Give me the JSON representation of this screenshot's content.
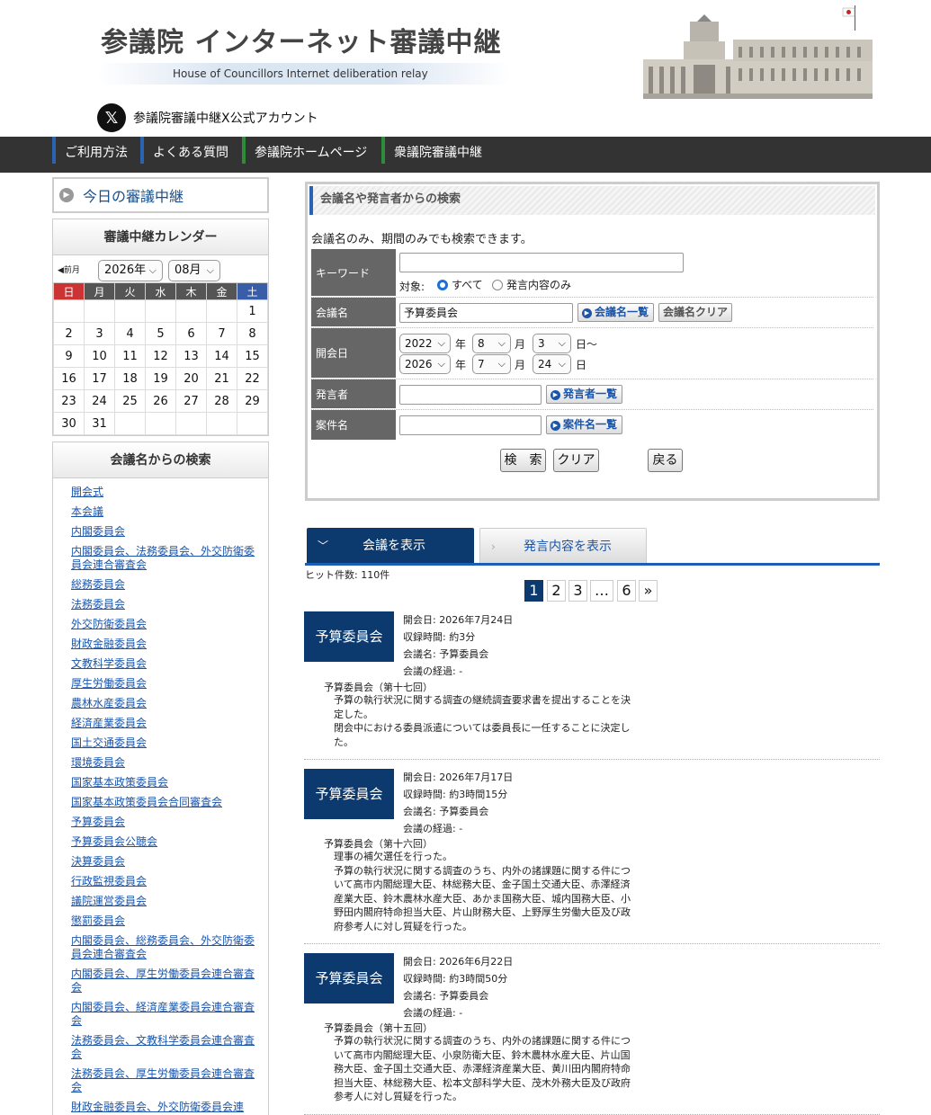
{
  "header": {
    "title": "参議院 インターネット審議中継",
    "subtitle": "House of Councillors Internet deliberation relay",
    "x_account": "参議院審議中継X公式アカウント"
  },
  "nav": {
    "items": [
      {
        "label": "ご利用方法",
        "color": "#2a63b0"
      },
      {
        "label": "よくある質問",
        "color": "#2a63b0"
      },
      {
        "label": "参議院ホームページ",
        "color": "#2e8b3a"
      },
      {
        "label": "衆議院審議中継",
        "color": "#2e8b3a"
      }
    ]
  },
  "sidebar": {
    "today": "今日の審議中継",
    "calendar": {
      "title": "審議中継カレンダー",
      "prev": "◀前月",
      "year": "2026年",
      "month": "08月",
      "weekdays": [
        "日",
        "月",
        "火",
        "水",
        "木",
        "金",
        "土"
      ],
      "weeks": [
        [
          "",
          "",
          "",
          "",
          "",
          "",
          "1"
        ],
        [
          "2",
          "3",
          "4",
          "5",
          "6",
          "7",
          "8"
        ],
        [
          "9",
          "10",
          "11",
          "12",
          "13",
          "14",
          "15"
        ],
        [
          "16",
          "17",
          "18",
          "19",
          "20",
          "21",
          "22"
        ],
        [
          "23",
          "24",
          "25",
          "26",
          "27",
          "28",
          "29"
        ],
        [
          "30",
          "31",
          "",
          "",
          "",
          "",
          ""
        ]
      ]
    },
    "committee_search": {
      "title": "会議名からの検索",
      "links": [
        "開会式",
        "本会議",
        "内閣委員会",
        "内閣委員会、法務委員会、外交防衛委員会連合審査会",
        "総務委員会",
        "法務委員会",
        "外交防衛委員会",
        "財政金融委員会",
        "文教科学委員会",
        "厚生労働委員会",
        "農林水産委員会",
        "経済産業委員会",
        "国土交通委員会",
        "環境委員会",
        "国家基本政策委員会",
        "国家基本政策委員会合同審査会",
        "予算委員会",
        "予算委員会公聴会",
        "決算委員会",
        "行政監視委員会",
        "議院運営委員会",
        "懲罰委員会",
        "内閣委員会、総務委員会、外交防衛委員会連合審査会",
        "内閣委員会、厚生労働委員会連合審査会",
        "内閣委員会、経済産業委員会連合審査会",
        "法務委員会、文教科学委員会連合審査会",
        "法務委員会、厚生労働委員会連合審査会",
        "財政金融委員会、外交防衛委員会連"
      ]
    }
  },
  "search": {
    "title": "会議名や発言者からの検索",
    "note": "会議名のみ、期間のみでも検索できます。",
    "keyword_label": "キーワード",
    "keyword_value": "",
    "target_label": "対象:",
    "target_all": "すべて",
    "target_speech": "発言内容のみ",
    "meeting_label": "会議名",
    "meeting_value": "予算委員会",
    "meeting_list_btn": "会議名一覧",
    "meeting_clear_btn": "会議名クリア",
    "date_label": "開会日",
    "from": {
      "year": "2022",
      "month": "8",
      "day": "3"
    },
    "to": {
      "year": "2026",
      "month": "7",
      "day": "24"
    },
    "unit_year": "年",
    "unit_month": "月",
    "unit_day_from": "日～",
    "unit_day_to": "日",
    "speaker_label": "発言者",
    "speaker_value": "",
    "speaker_list_btn": "発言者一覧",
    "subject_label": "案件名",
    "subject_value": "",
    "subject_list_btn": "案件名一覧",
    "search_btn": "検　索",
    "clear_btn": "クリア",
    "back_btn": "戻る"
  },
  "tabs": {
    "meetings": "会議を表示",
    "speeches": "発言内容を表示"
  },
  "results": {
    "hits": "ヒット件数: 110件",
    "pages": [
      "1",
      "2",
      "3",
      "…",
      "6",
      "»"
    ],
    "items": [
      {
        "badge": "予算委員会",
        "date": "開会日: 2026年7月24日",
        "duration": "収録時間: 約3分",
        "meeting": "会議名: 予算委員会",
        "progress": "会議の経過: -",
        "session": "予算委員会（第十七回）",
        "summary": [
          "予算の執行状況に関する調査の継続調査要求書を提出することを決定した。",
          "閉会中における委員派遣については委員長に一任することに決定した。"
        ]
      },
      {
        "badge": "予算委員会",
        "date": "開会日: 2026年7月17日",
        "duration": "収録時間: 約3時間15分",
        "meeting": "会議名: 予算委員会",
        "progress": "会議の経過: -",
        "session": "予算委員会（第十六回）",
        "summary": [
          "理事の補欠選任を行った。",
          "予算の執行状況に関する調査のうち、内外の諸課題に関する件について高市内閣総理大臣、林総務大臣、金子国土交通大臣、赤澤経済産業大臣、鈴木農林水産大臣、あかま国務大臣、城内国務大臣、小野田内閣府特命担当大臣、片山財務大臣、上野厚生労働大臣及び政府参考人に対し質疑を行った。"
        ]
      },
      {
        "badge": "予算委員会",
        "date": "開会日: 2026年6月22日",
        "duration": "収録時間: 約3時間50分",
        "meeting": "会議名: 予算委員会",
        "progress": "会議の経過: -",
        "session": "予算委員会（第十五回）",
        "summary": [
          "予算の執行状況に関する調査のうち、内外の諸課題に関する件について高市内閣総理大臣、小泉防衛大臣、鈴木農林水産大臣、片山国務大臣、金子国土交通大臣、赤澤経済産業大臣、黄川田内閣府特命担当大臣、林総務大臣、松本文部科学大臣、茂木外務大臣及び政府参考人に対し質疑を行った。"
        ]
      }
    ]
  }
}
